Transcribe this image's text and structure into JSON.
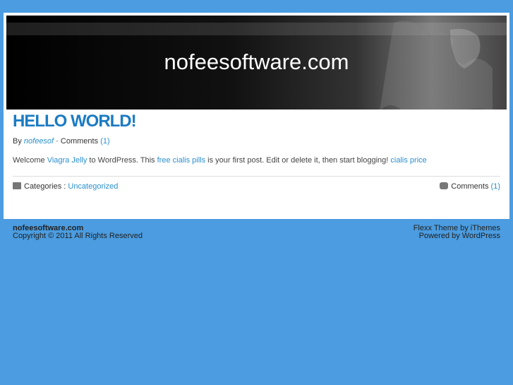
{
  "site": {
    "title": "nofeesoftware.com"
  },
  "post": {
    "title": "HELLO WORLD!",
    "by": "By",
    "author": "nofeesof",
    "sep": "·",
    "comments_label": "Comments",
    "comments_count": "(1)",
    "content": [
      "Welcome ",
      "Viagra Jelly",
      " to WordPress. This ",
      "free cialis pills",
      " is your first post. Edit or delete it, then start blogging! ",
      "cialis price"
    ],
    "categories_label": "Categories :",
    "category": "Uncategorized"
  },
  "footer": {
    "site": "nofeesoftware.com",
    "copyright": "Copyright © 2011 All Rights Reserved",
    "theme": "Flexx Theme by iThemes",
    "powered": "Powered by WordPress"
  }
}
